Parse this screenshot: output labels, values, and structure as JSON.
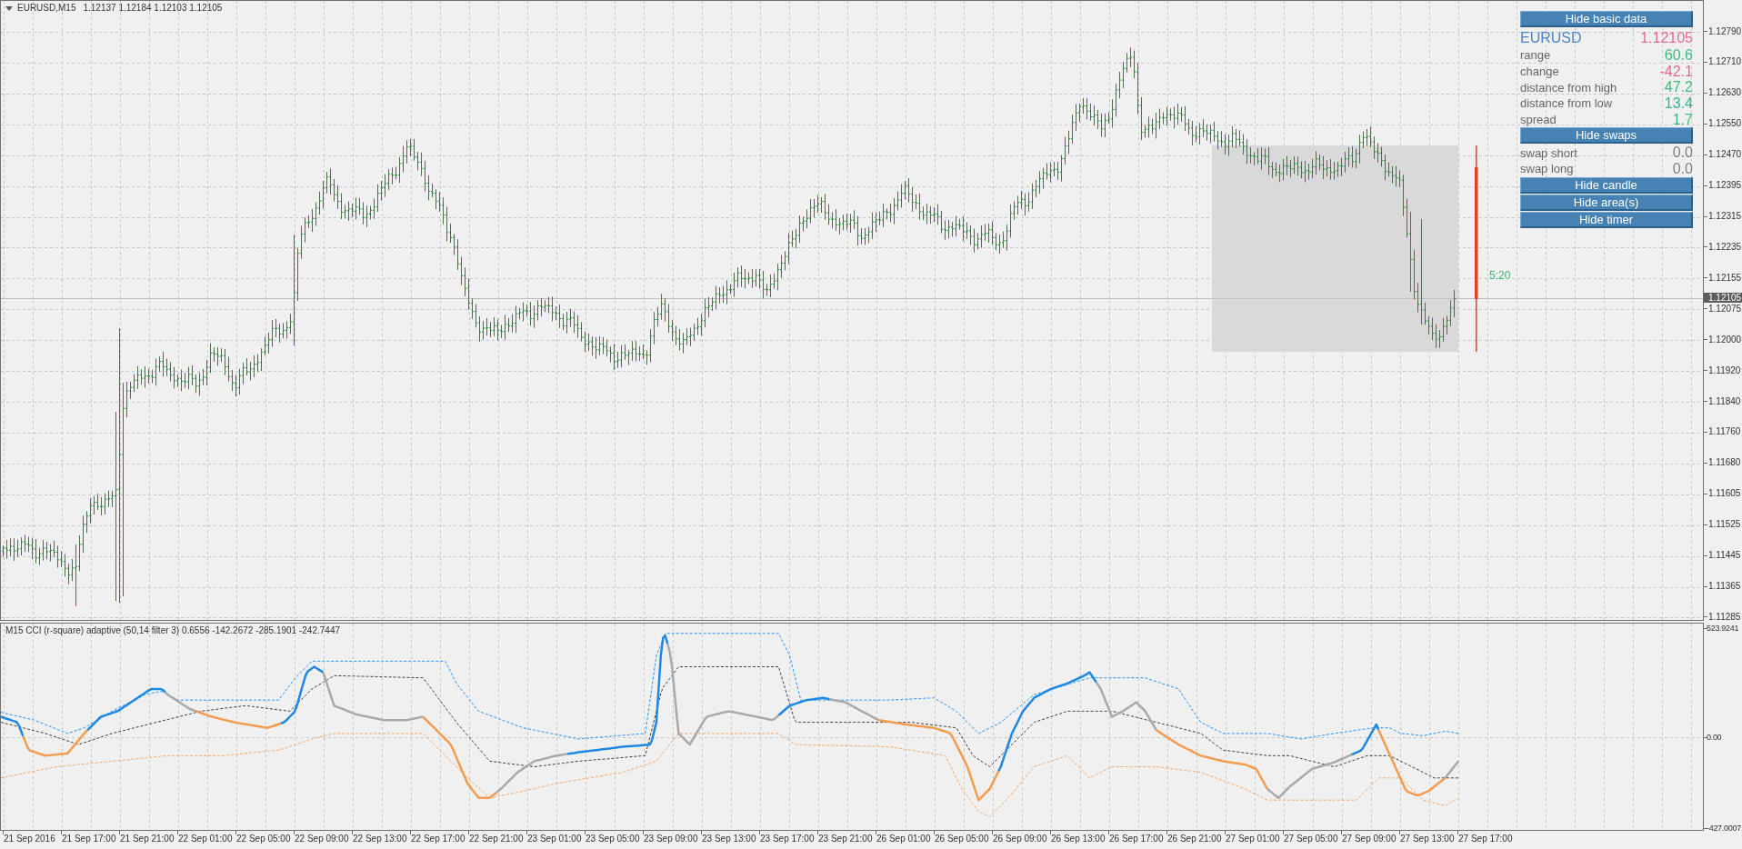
{
  "chart_header": {
    "symbol": "EURUSD,M15",
    "quotes": "1.12137 1.12184 1.12103 1.12105"
  },
  "info_panel": {
    "items": [
      {
        "kind": "button",
        "label": "Hide basic data"
      },
      {
        "kind": "title",
        "label": "EURUSD",
        "value": "1.12105",
        "color": "#e36a94"
      },
      {
        "kind": "row",
        "label": "range",
        "value": "60.6",
        "color": "#3dbb7c"
      },
      {
        "kind": "row",
        "label": "change",
        "value": "-42.1",
        "color": "#e36a94"
      },
      {
        "kind": "row",
        "label": "distance from high",
        "value": "47.2",
        "color": "#3dbb7c"
      },
      {
        "kind": "row",
        "label": "distance from low",
        "value": "13.4",
        "color": "#2fb592"
      },
      {
        "kind": "row",
        "label": "spread",
        "value": "1.7",
        "color": "#3dbb7c"
      },
      {
        "kind": "button",
        "label": "Hide swaps"
      },
      {
        "kind": "row",
        "label": "swap short",
        "value": "0.0",
        "color": "#808080"
      },
      {
        "kind": "row",
        "label": "swap long",
        "value": "0.0",
        "color": "#808080"
      },
      {
        "kind": "button",
        "label": "Hide candle"
      },
      {
        "kind": "button",
        "label": "Hide area(s)"
      },
      {
        "kind": "button",
        "label": "Hide timer"
      }
    ]
  },
  "timer": "5:20",
  "price_axis": {
    "labels": [
      "1.12790",
      "1.12710",
      "1.12630",
      "1.12550",
      "1.12470",
      "1.12395",
      "1.12315",
      "1.12235",
      "1.12155",
      "1.12075",
      "1.12000",
      "1.11920",
      "1.11840",
      "1.11760",
      "1.11680",
      "1.11605",
      "1.11525",
      "1.11445",
      "1.11365",
      "1.11285"
    ],
    "current_price": "1.12105"
  },
  "indicator": {
    "title": "M15 CCI (r-square) adaptive (50,14 filter 3) 0.6556 -142.2672 -285.1901 -242.7447",
    "axis_labels": [
      "523.9241",
      "0.00",
      "-427.0007"
    ]
  },
  "time_axis": {
    "labels": [
      "21 Sep 2016",
      "21 Sep 17:00",
      "21 Sep 21:00",
      "22 Sep 01:00",
      "22 Sep 05:00",
      "22 Sep 09:00",
      "22 Sep 13:00",
      "22 Sep 17:00",
      "22 Sep 21:00",
      "23 Sep 01:00",
      "23 Sep 05:00",
      "23 Sep 09:00",
      "23 Sep 13:00",
      "23 Sep 17:00",
      "23 Sep 21:00",
      "26 Sep 01:00",
      "26 Sep 05:00",
      "26 Sep 09:00",
      "26 Sep 13:00",
      "26 Sep 17:00",
      "26 Sep 21:00",
      "27 Sep 01:00",
      "27 Sep 05:00",
      "27 Sep 09:00",
      "27 Sep 13:00",
      "27 Sep 17:00"
    ]
  }
}
